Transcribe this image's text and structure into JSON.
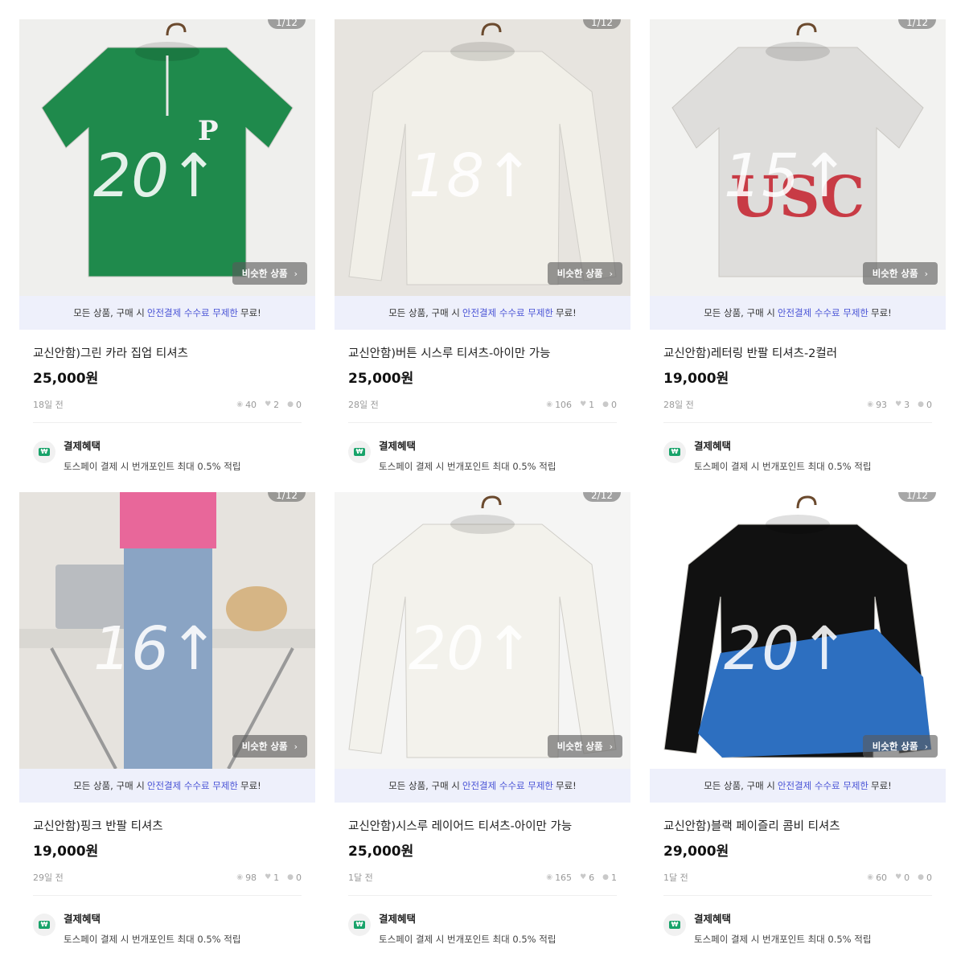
{
  "cards": [
    {
      "counter": "1/12",
      "title": "교신안함)그린 카라 집업 티셔츠",
      "price": "25,000원",
      "age": "18일 전",
      "views": "40",
      "likes": "2",
      "chats": "0",
      "watermark": "20↑",
      "shirt_color": "#1f8a4c",
      "bg_color": "#efefed"
    },
    {
      "counter": "1/12",
      "title": "교신안함)버튼 시스루 티셔츠-아이만 가능",
      "price": "25,000원",
      "age": "28일 전",
      "views": "106",
      "likes": "1",
      "chats": "0",
      "watermark": "18↑",
      "shirt_color": "#f1efe8",
      "bg_color": "#e7e4df"
    },
    {
      "counter": "1/12",
      "title": "교신안함)레터링 반팔 티셔츠-2컬러",
      "price": "19,000원",
      "age": "28일 전",
      "views": "93",
      "likes": "3",
      "chats": "0",
      "watermark": "15↑",
      "shirt_color": "#dedddb",
      "bg_color": "#f2f2f0",
      "print_text": "USC"
    },
    {
      "counter": "1/12",
      "title": "교신안함)핑크 반팔 티셔츠",
      "price": "19,000원",
      "age": "29일 전",
      "views": "98",
      "likes": "1",
      "chats": "0",
      "watermark": "16↑",
      "shirt_color": "#e8679a",
      "bg_color": "#ebe9e5"
    },
    {
      "counter": "2/12",
      "title": "교신안함)시스루 레이어드 티셔츠-아이만 가능",
      "price": "25,000원",
      "age": "1달 전",
      "views": "165",
      "likes": "6",
      "chats": "1",
      "watermark": "20↑",
      "shirt_color": "#f3f2ec",
      "bg_color": "#f5f5f4"
    },
    {
      "counter": "1/12",
      "title": "교신안함)블랙 페이즐리 콤비 티셔츠",
      "price": "29,000원",
      "age": "1달 전",
      "views": "60",
      "likes": "0",
      "chats": "0",
      "watermark": "20↑",
      "shirt_color": "#111111",
      "bg_color": "#ffffff",
      "accent_color": "#2d6fc0"
    }
  ],
  "common": {
    "similar_label": "비슷한 상품",
    "notice_prefix": "모든 상품, 구매 시",
    "notice_highlight": "안전결제 수수료 무제한",
    "notice_suffix": "무료!",
    "benefit_title": "결제혜택",
    "benefit_desc": "토스페이 결제 시 번개포인트 최대 0.5% 적립",
    "icons": {
      "chevron": "chevron-right-icon",
      "views": "eye-icon",
      "likes": "heart-icon",
      "chats": "chat-icon",
      "pay": "pay-logo-icon"
    },
    "highlight_color": "#4b55d6",
    "notice_bg": "#eef0fb"
  }
}
